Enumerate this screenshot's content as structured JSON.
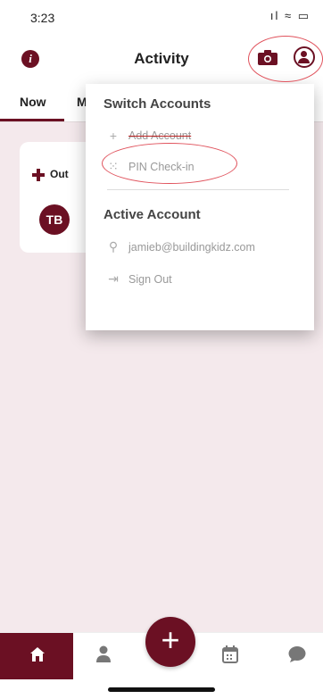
{
  "status_bar": {
    "time": "3:23",
    "icons": "ıl ≈ ▭"
  },
  "header": {
    "title": "Activity"
  },
  "tabs": [
    {
      "label": "Now"
    },
    {
      "label": "M"
    }
  ],
  "card": {
    "label": "Out",
    "avatar_initials": "TB"
  },
  "dropdown": {
    "switch_heading": "Switch Accounts",
    "add_account": "Add Account",
    "pin_checkin": "PIN Check-in",
    "active_heading": "Active Account",
    "email": "jamieb@buildingkidz.com",
    "sign_out": "Sign Out"
  },
  "colors": {
    "brand": "#6b1023",
    "background": "#f4e9ec",
    "annotation": "#e0525c"
  },
  "icons": [
    "info-icon",
    "camera-icon",
    "account-icon",
    "plus-icon",
    "pin-icon",
    "user-icon",
    "sign-out-icon",
    "home-icon",
    "person-icon",
    "add-icon",
    "calendar-icon",
    "chat-icon"
  ]
}
